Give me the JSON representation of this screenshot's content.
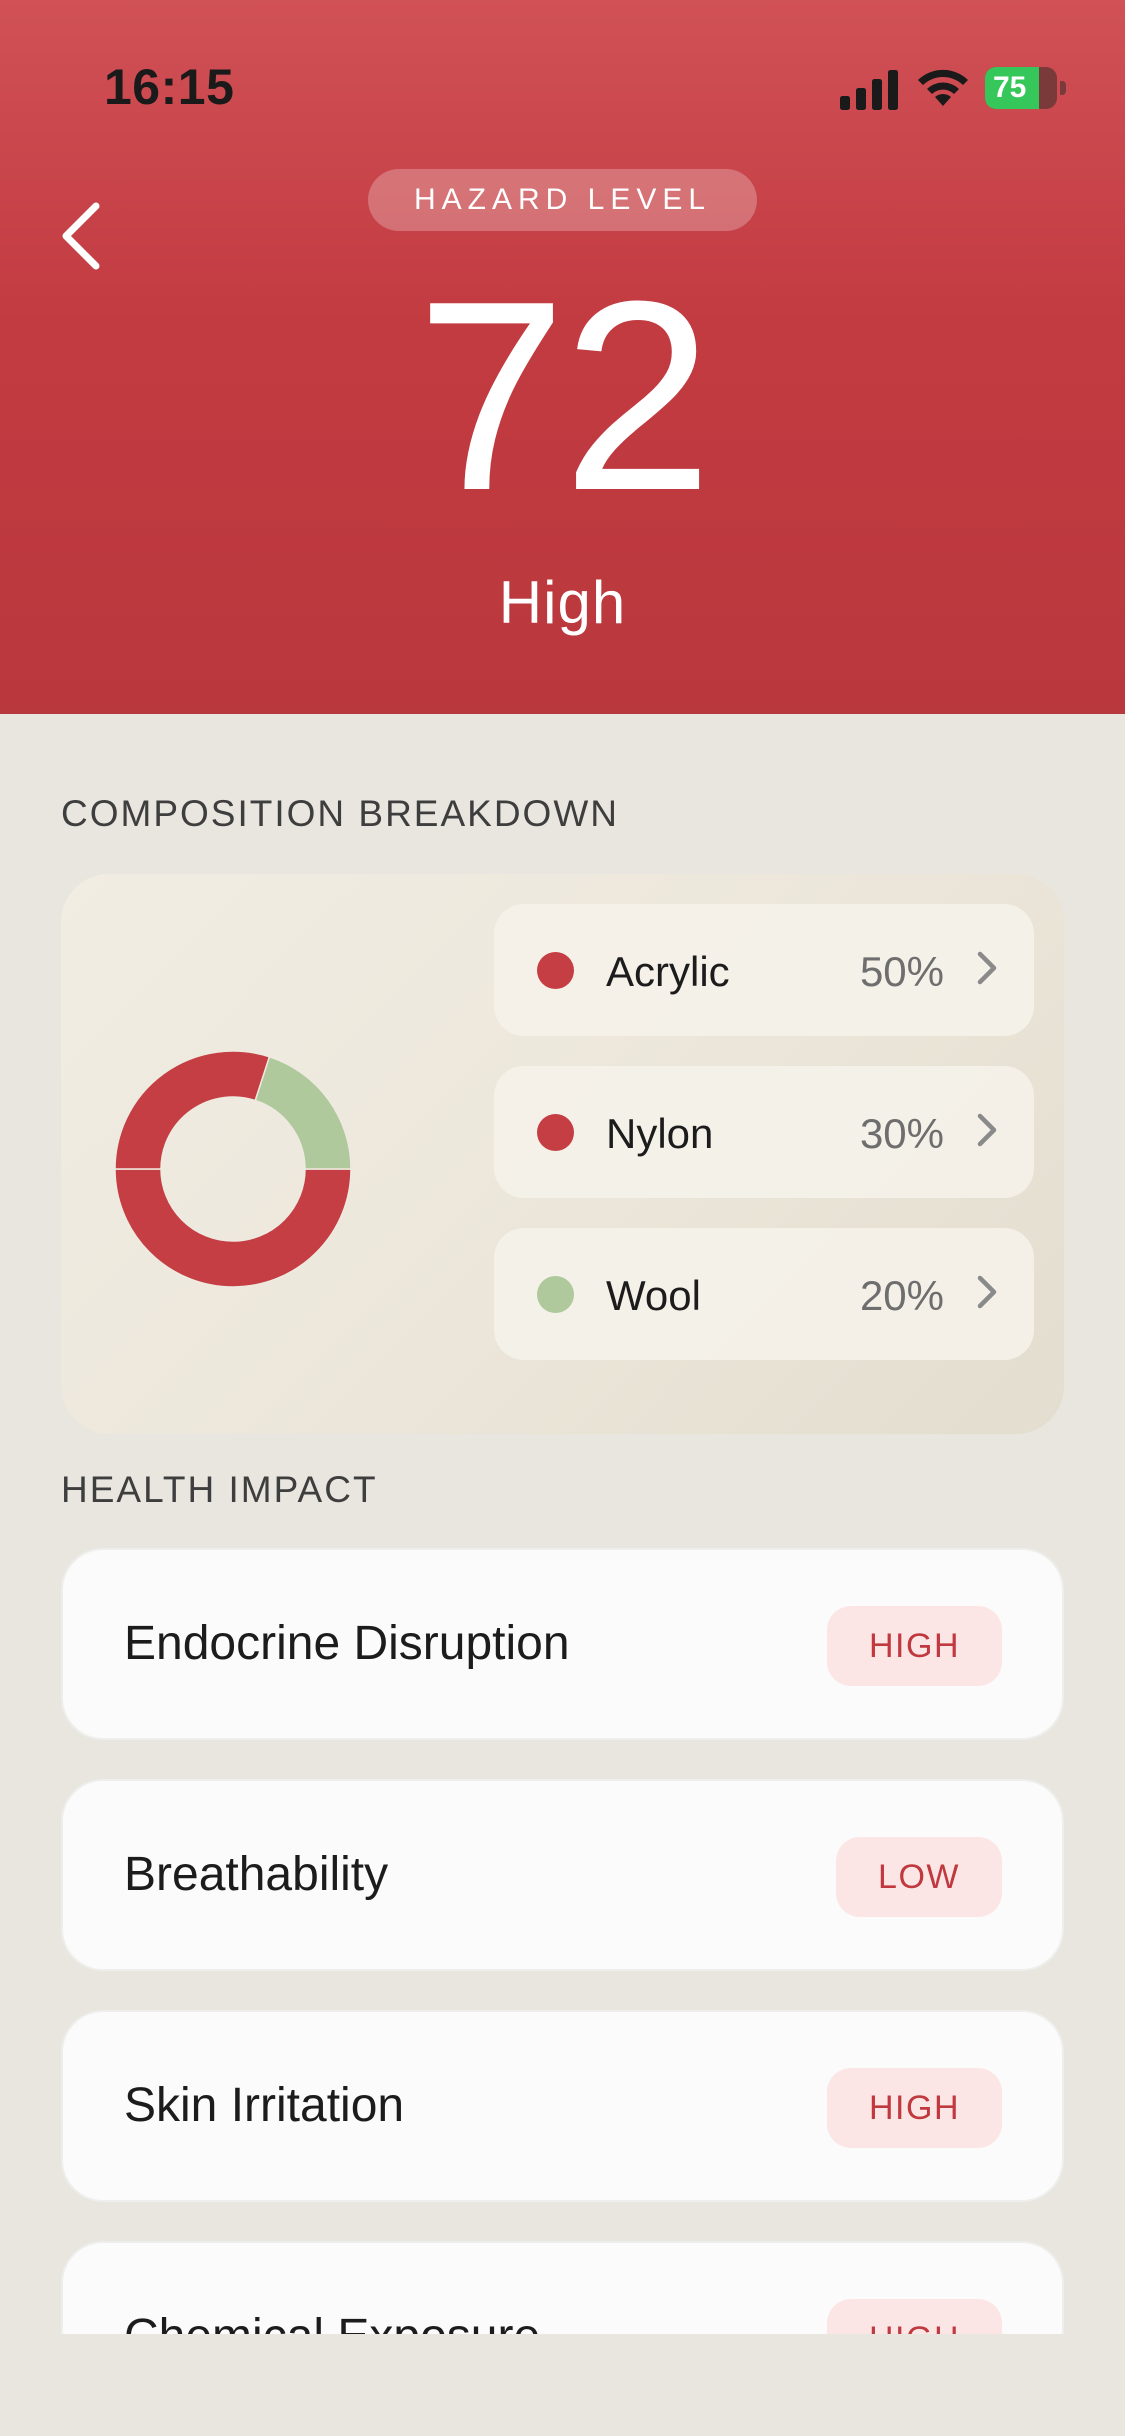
{
  "status_bar": {
    "time": "16:15",
    "battery": 75
  },
  "header": {
    "pill_label": "HAZARD LEVEL",
    "score": "72",
    "level": "High",
    "color_top": "#d05156",
    "color_bottom": "#b9383d"
  },
  "composition": {
    "title": "COMPOSITION BREAKDOWN",
    "items": [
      {
        "name": "Acrylic",
        "percent_label": "50%",
        "value": 50,
        "color": "#c43e44"
      },
      {
        "name": "Nylon",
        "percent_label": "30%",
        "value": 30,
        "color": "#c43e44"
      },
      {
        "name": "Wool",
        "percent_label": "20%",
        "value": 20,
        "color": "#afc89c"
      }
    ]
  },
  "health": {
    "title": "HEALTH IMPACT",
    "items": [
      {
        "label": "Endocrine Disruption",
        "badge": "HIGH"
      },
      {
        "label": "Breathability",
        "badge": "LOW"
      },
      {
        "label": "Skin Irritation",
        "badge": "HIGH"
      },
      {
        "label": "Chemical Exposure",
        "badge": "HIGH"
      }
    ]
  },
  "icons": {
    "back": "chevron-left-icon",
    "row_chevron": "chevron-right-icon"
  }
}
